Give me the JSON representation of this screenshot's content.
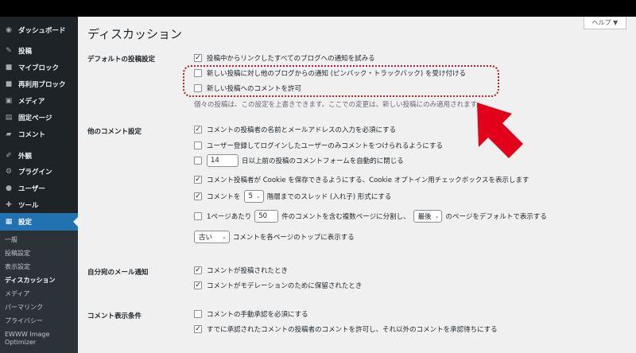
{
  "help": {
    "label": "ヘルプ ▼"
  },
  "page_title": "ディスカッション",
  "sidebar": {
    "dashboard": "ダッシュボード",
    "posts": "投稿",
    "my_blocks": "マイブロック",
    "reusable_blocks": "再利用ブロック",
    "media": "メディア",
    "pages": "固定ページ",
    "comments": "コメント",
    "appearance": "外観",
    "plugins": "プラグイン",
    "users": "ユーザー",
    "tools": "ツール",
    "settings": "設定"
  },
  "submenu": {
    "general": "一般",
    "writing": "投稿設定",
    "reading": "表示設定",
    "discussion": "ディスカッション",
    "media": "メディア",
    "permalinks": "パーマリンク",
    "privacy": "プライバシー",
    "ewww1": "EWWW Image",
    "ewww2": "Optimizer"
  },
  "sections": {
    "default_post": {
      "label": "デフォルトの投稿設定",
      "items": [
        {
          "text": "投稿中からリンクしたすべてのブログへの通知を試みる",
          "checked": true
        },
        {
          "text": "新しい投稿に対し他のブログからの通知 (ピンバック・トラックバック) を受け付ける",
          "checked": false
        },
        {
          "text": "新しい投稿へのコメントを許可",
          "checked": false
        }
      ],
      "description": "個々の投稿は、この設定を上書きできます。ここでの変更は、新しい投稿にのみ適用されます。"
    },
    "other_comment": {
      "label": "他のコメント設定",
      "require_name_email": "コメントの投稿者の名前とメールアドレスの入力を必須にする",
      "registered_only": "ユーザー登録してログインしたユーザーのみコメントをつけられるようにする",
      "close_days_value": "14",
      "close_days_text": "日以上前の投稿のコメントフォームを自動的に閉じる",
      "cookies": "コメント投稿者が Cookie を保存できるようにする、Cookie オプトイン用チェックボックスを表示します",
      "thread_prefix": "コメントを",
      "thread_value": "5",
      "thread_suffix": "階層までのスレッド (入れ子) 形式にする",
      "paginate_prefix": "1ページあたり",
      "paginate_value": "50",
      "paginate_mid": "件のコメントを含む複数ページに分割し、",
      "paginate_select": "最後",
      "paginate_suffix": "のページをデフォルトで表示する",
      "order_select": "古い",
      "order_suffix": "コメントを各ページのトップに表示する"
    },
    "email_me": {
      "label": "自分宛のメール通知",
      "items": [
        {
          "text": "コメントが投稿されたとき",
          "checked": true
        },
        {
          "text": "コメントがモデレーションのために保留されたとき",
          "checked": true
        }
      ]
    },
    "before_comment": {
      "label": "コメント表示条件",
      "items": [
        {
          "text": "コメントの手動承認を必須にする",
          "checked": false
        },
        {
          "text": "すでに承認されたコメントの投稿者のコメントを許可し、それ以外のコメントを承認待ちにする",
          "checked": true
        }
      ]
    }
  },
  "colors": {
    "accent": "#2271b1",
    "arrow": "#e3001b",
    "highlight": "#b02222"
  }
}
